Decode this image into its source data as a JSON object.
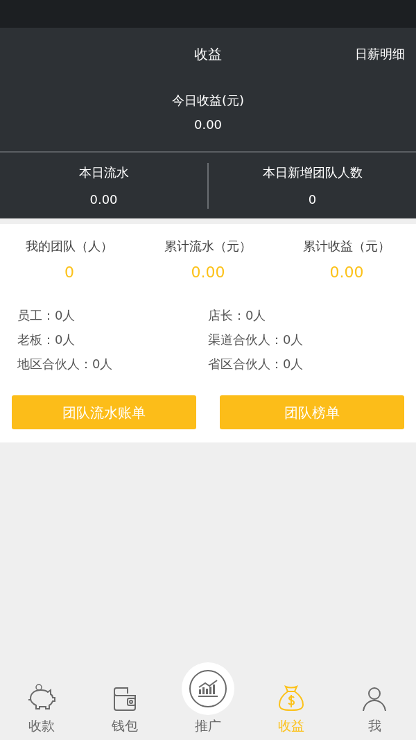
{
  "header": {
    "title": "收益",
    "action": "日薪明细",
    "today_label": "今日收益(元)",
    "today_value": "0.00",
    "stats": [
      {
        "label": "本日流水",
        "value": "0.00"
      },
      {
        "label": "本日新增团队人数",
        "value": "0"
      }
    ]
  },
  "summary": [
    {
      "label": "我的团队（人）",
      "value": "0"
    },
    {
      "label": "累计流水（元）",
      "value": "0.00"
    },
    {
      "label": "累计收益（元）",
      "value": "0.00"
    }
  ],
  "roles": [
    {
      "label": "员工：0人"
    },
    {
      "label": "店长：0人"
    },
    {
      "label": "老板：0人"
    },
    {
      "label": "渠道合伙人：0人"
    },
    {
      "label": "地区合伙人：0人"
    },
    {
      "label": "省区合伙人：0人"
    }
  ],
  "buttons": [
    "团队流水账单",
    "团队榜单"
  ],
  "nav": [
    {
      "kind": "piggy",
      "label": "收款",
      "selected": false
    },
    {
      "kind": "wallet",
      "label": "钱包",
      "selected": false
    },
    {
      "kind": "chart",
      "label": "推广",
      "selected": false
    },
    {
      "kind": "moneybag",
      "label": "收益",
      "selected": true
    },
    {
      "kind": "person",
      "label": "我",
      "selected": false
    }
  ]
}
